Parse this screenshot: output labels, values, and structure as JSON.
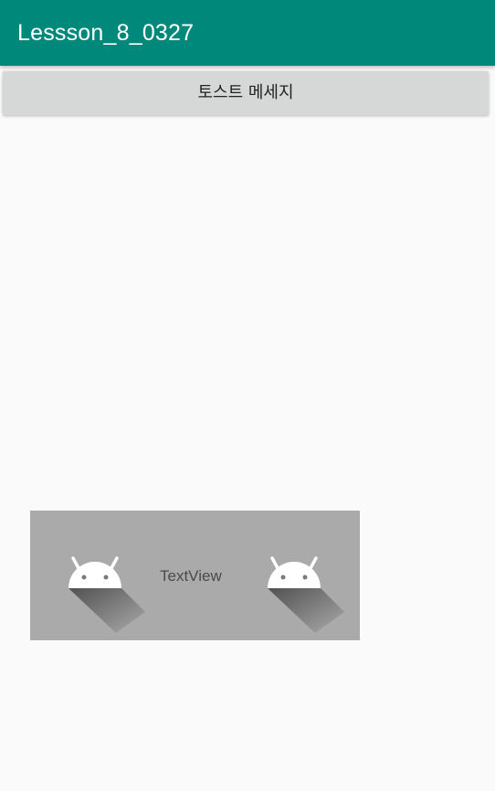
{
  "app_bar": {
    "title": "Lessson_8_0327",
    "color": "#00897b"
  },
  "main": {
    "toast_button_label": "토스트 메세지"
  },
  "toast_panel": {
    "text": "TextView",
    "icons": [
      "android-icon",
      "android-icon"
    ],
    "background": "#aaaaaa"
  }
}
